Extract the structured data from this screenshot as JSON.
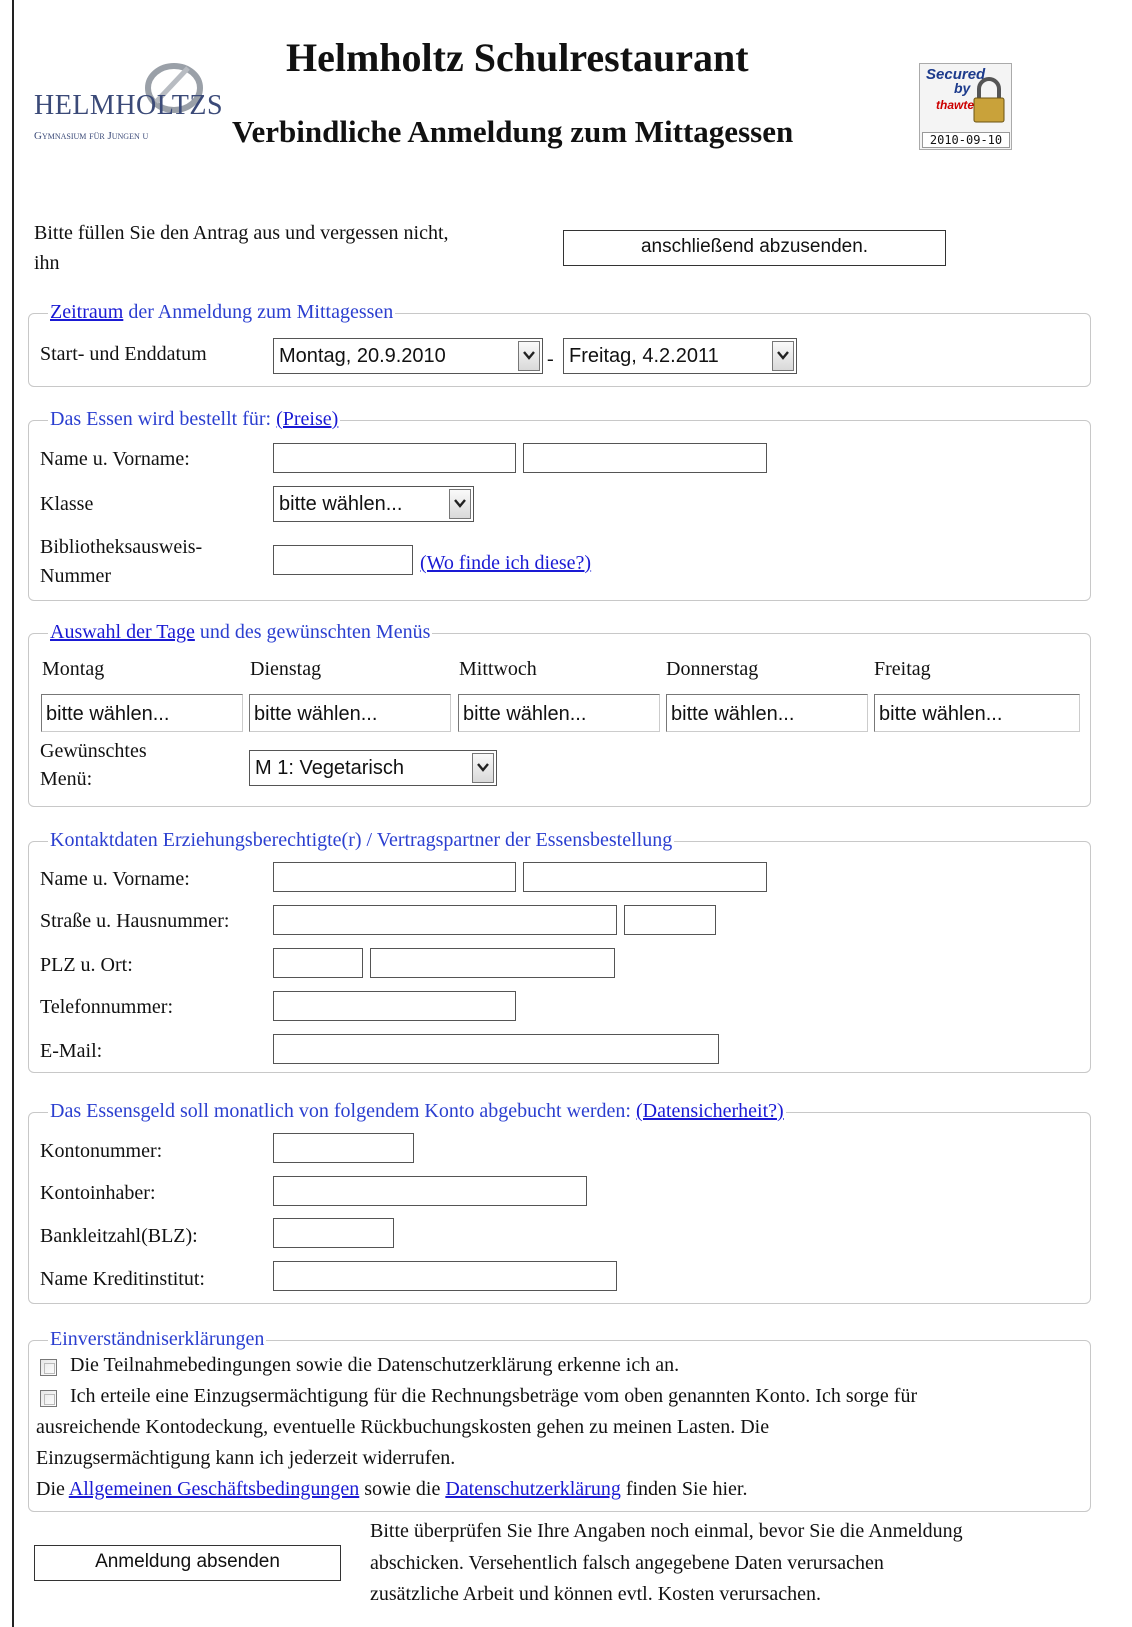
{
  "header": {
    "logo_name": "HELMHOLTZS",
    "logo_subtitle": "Gymnasium für Jungen u",
    "title": "Helmholtz Schulrestaurant",
    "subtitle": "Verbindliche Anmeldung zum Mittagessen",
    "seal": {
      "line1": "Secured",
      "line2": "by",
      "line3": "thawte",
      "date": "2010-09-10"
    }
  },
  "intro": {
    "text_line1": "Bitte füllen Sie den Antrag aus und vergessen nicht,",
    "text_line2": "ihn",
    "submit_label": "anschließend abzusenden."
  },
  "zeitraum": {
    "legend_link": "Zeitraum",
    "legend_rest": " der Anmeldung zum Mittagessen",
    "label": "Start- und Enddatum",
    "start_value": "Montag, 20.9.2010",
    "separator": "-",
    "end_value": "Freitag, 4.2.2011"
  },
  "essen": {
    "legend_text": "Das Essen wird bestellt für: ",
    "legend_link": "(Preise)",
    "name_label": "Name u. Vorname:",
    "klasse_label": "Klasse",
    "klasse_value": "bitte wählen...",
    "bib_label_line1": "Bibliotheksausweis-",
    "bib_label_line2": "Nummer",
    "bib_help_link": "(Wo finde ich diese?)"
  },
  "tage": {
    "legend_link": "Auswahl der Tage",
    "legend_rest": " und des gewünschten Menüs",
    "days": [
      {
        "name": "Montag",
        "value": "bitte wählen..."
      },
      {
        "name": "Dienstag",
        "value": "bitte wählen..."
      },
      {
        "name": "Mittwoch",
        "value": "bitte wählen..."
      },
      {
        "name": "Donnerstag",
        "value": "bitte wählen..."
      },
      {
        "name": "Freitag",
        "value": "bitte wählen..."
      }
    ],
    "menu_label_line1": "Gewünschtes",
    "menu_label_line2": "Menü:",
    "menu_value": "M 1: Vegetarisch"
  },
  "kontakt": {
    "legend": "Kontaktdaten Erziehungsberechtigte(r) / Vertragspartner der Essensbestellung",
    "name_label": "Name u. Vorname:",
    "street_label": "Straße u. Hausnummer:",
    "plz_label": "PLZ u. Ort:",
    "phone_label": "Telefonnummer:",
    "email_label": "E-Mail:"
  },
  "konto": {
    "legend_text": "Das Essensgeld soll monatlich von folgendem Konto abgebucht werden: ",
    "legend_link": "(Datensicherheit?)",
    "kontonummer_label": "Kontonummer:",
    "kontoinhaber_label": "Kontoinhaber:",
    "blz_label": "Bankleitzahl(BLZ):",
    "bank_label": "Name Kreditinstitut:"
  },
  "einverstaendnis": {
    "legend": "Einverständniserklärungen",
    "check1": "Die Teilnahmebedingungen sowie die Datenschutzerklärung erkenne ich an.",
    "check2_line1": "Ich erteile eine Einzugsermächtigung für die Rechnungsbeträge vom oben genannten Konto. Ich sorge für",
    "check2_line2": "ausreichende Kontodeckung, eventuelle Rückbuchungskosten gehen zu meinen Lasten. Die",
    "check2_line3": "Einzugsermächtigung kann ich jederzeit widerrufen.",
    "footer_pre": "Die ",
    "agb_link": "Allgemeinen Geschäftsbedingungen",
    "footer_mid": " sowie die ",
    "ds_link": "Datenschutzerklärung",
    "footer_post": " finden Sie hier."
  },
  "footer": {
    "submit_label": "Anmeldung absenden",
    "note_line1": "Bitte überprüfen Sie Ihre Angaben noch einmal, bevor Sie die Anmeldung",
    "note_line2": "abschicken. Versehentlich falsch angegebene Daten verursachen",
    "note_line3": "zusätzliche Arbeit und können evtl. Kosten verursachen."
  }
}
